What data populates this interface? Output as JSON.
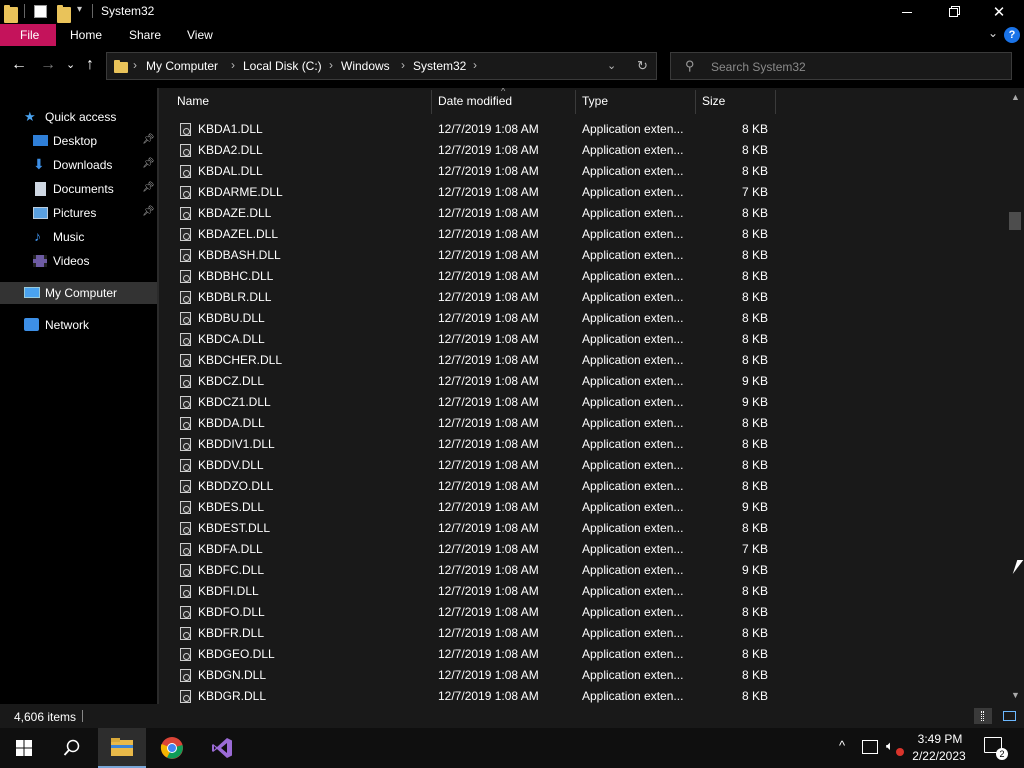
{
  "window": {
    "title": "System32"
  },
  "ribbon": {
    "tabs": [
      "File",
      "Home",
      "Share",
      "View"
    ],
    "help": "?"
  },
  "address": {
    "crumbs": [
      "My Computer",
      "Local Disk (C:)",
      "Windows",
      "System32"
    ]
  },
  "search": {
    "placeholder": "Search System32"
  },
  "sidebar": {
    "items": [
      {
        "label": "Quick access",
        "icon": "star-icon"
      },
      {
        "label": "Desktop",
        "icon": "desktop-icon",
        "pinned": true
      },
      {
        "label": "Downloads",
        "icon": "download-icon",
        "pinned": true
      },
      {
        "label": "Documents",
        "icon": "document-icon",
        "pinned": true
      },
      {
        "label": "Pictures",
        "icon": "picture-icon",
        "pinned": true
      },
      {
        "label": "Music",
        "icon": "music-icon"
      },
      {
        "label": "Videos",
        "icon": "video-icon"
      },
      {
        "label": "My Computer",
        "icon": "computer-icon",
        "selected": true
      },
      {
        "label": "Network",
        "icon": "network-icon"
      }
    ]
  },
  "columns": {
    "name": "Name",
    "date": "Date modified",
    "type": "Type",
    "size": "Size"
  },
  "files": [
    {
      "name": "KBDA1.DLL",
      "date": "12/7/2019 1:08 AM",
      "type": "Application exten...",
      "size": "8 KB"
    },
    {
      "name": "KBDA2.DLL",
      "date": "12/7/2019 1:08 AM",
      "type": "Application exten...",
      "size": "8 KB"
    },
    {
      "name": "KBDAL.DLL",
      "date": "12/7/2019 1:08 AM",
      "type": "Application exten...",
      "size": "8 KB"
    },
    {
      "name": "KBDARME.DLL",
      "date": "12/7/2019 1:08 AM",
      "type": "Application exten...",
      "size": "7 KB"
    },
    {
      "name": "KBDAZE.DLL",
      "date": "12/7/2019 1:08 AM",
      "type": "Application exten...",
      "size": "8 KB"
    },
    {
      "name": "KBDAZEL.DLL",
      "date": "12/7/2019 1:08 AM",
      "type": "Application exten...",
      "size": "8 KB"
    },
    {
      "name": "KBDBASH.DLL",
      "date": "12/7/2019 1:08 AM",
      "type": "Application exten...",
      "size": "8 KB"
    },
    {
      "name": "KBDBHC.DLL",
      "date": "12/7/2019 1:08 AM",
      "type": "Application exten...",
      "size": "8 KB"
    },
    {
      "name": "KBDBLR.DLL",
      "date": "12/7/2019 1:08 AM",
      "type": "Application exten...",
      "size": "8 KB"
    },
    {
      "name": "KBDBU.DLL",
      "date": "12/7/2019 1:08 AM",
      "type": "Application exten...",
      "size": "8 KB"
    },
    {
      "name": "KBDCA.DLL",
      "date": "12/7/2019 1:08 AM",
      "type": "Application exten...",
      "size": "8 KB"
    },
    {
      "name": "KBDCHER.DLL",
      "date": "12/7/2019 1:08 AM",
      "type": "Application exten...",
      "size": "8 KB"
    },
    {
      "name": "KBDCZ.DLL",
      "date": "12/7/2019 1:08 AM",
      "type": "Application exten...",
      "size": "9 KB"
    },
    {
      "name": "KBDCZ1.DLL",
      "date": "12/7/2019 1:08 AM",
      "type": "Application exten...",
      "size": "9 KB"
    },
    {
      "name": "KBDDA.DLL",
      "date": "12/7/2019 1:08 AM",
      "type": "Application exten...",
      "size": "8 KB"
    },
    {
      "name": "KBDDIV1.DLL",
      "date": "12/7/2019 1:08 AM",
      "type": "Application exten...",
      "size": "8 KB"
    },
    {
      "name": "KBDDV.DLL",
      "date": "12/7/2019 1:08 AM",
      "type": "Application exten...",
      "size": "8 KB"
    },
    {
      "name": "KBDDZO.DLL",
      "date": "12/7/2019 1:08 AM",
      "type": "Application exten...",
      "size": "8 KB"
    },
    {
      "name": "KBDES.DLL",
      "date": "12/7/2019 1:08 AM",
      "type": "Application exten...",
      "size": "9 KB"
    },
    {
      "name": "KBDEST.DLL",
      "date": "12/7/2019 1:08 AM",
      "type": "Application exten...",
      "size": "8 KB"
    },
    {
      "name": "KBDFA.DLL",
      "date": "12/7/2019 1:08 AM",
      "type": "Application exten...",
      "size": "7 KB"
    },
    {
      "name": "KBDFC.DLL",
      "date": "12/7/2019 1:08 AM",
      "type": "Application exten...",
      "size": "9 KB"
    },
    {
      "name": "KBDFI.DLL",
      "date": "12/7/2019 1:08 AM",
      "type": "Application exten...",
      "size": "8 KB"
    },
    {
      "name": "KBDFO.DLL",
      "date": "12/7/2019 1:08 AM",
      "type": "Application exten...",
      "size": "8 KB"
    },
    {
      "name": "KBDFR.DLL",
      "date": "12/7/2019 1:08 AM",
      "type": "Application exten...",
      "size": "8 KB"
    },
    {
      "name": "KBDGEO.DLL",
      "date": "12/7/2019 1:08 AM",
      "type": "Application exten...",
      "size": "8 KB"
    },
    {
      "name": "KBDGN.DLL",
      "date": "12/7/2019 1:08 AM",
      "type": "Application exten...",
      "size": "8 KB"
    },
    {
      "name": "KBDGR.DLL",
      "date": "12/7/2019 1:08 AM",
      "type": "Application exten...",
      "size": "8 KB"
    }
  ],
  "status": {
    "item_count": "4,606 items"
  },
  "taskbar": {
    "apps": [
      "start-icon",
      "search-icon",
      "file-explorer-icon",
      "chrome-icon",
      "visual-studio-icon"
    ],
    "time": "3:49 PM",
    "date": "2/22/2023",
    "notifications": "2"
  },
  "colors": {
    "accent_file_tab": "#c4135b",
    "selection": "#333333",
    "list_bg": "#191919"
  }
}
